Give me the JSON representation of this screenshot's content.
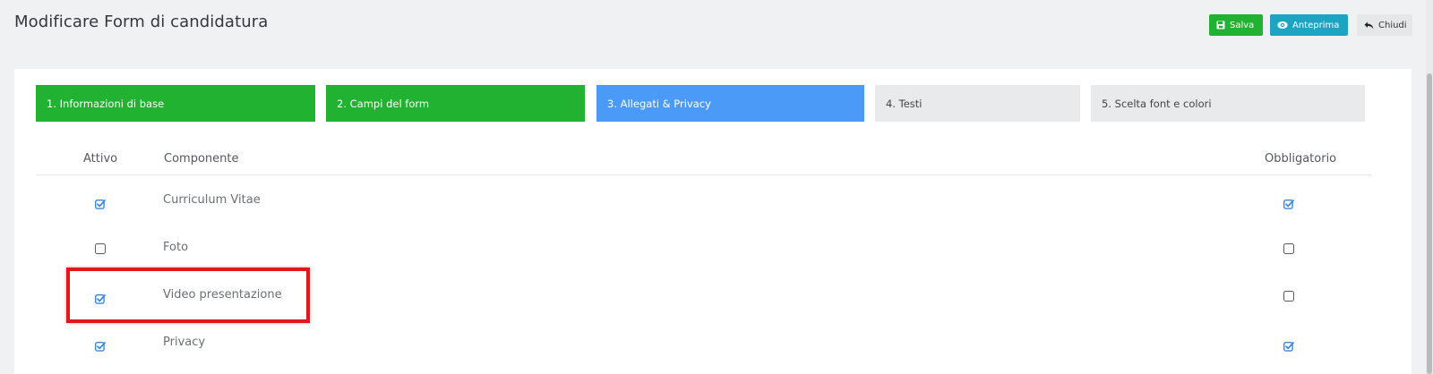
{
  "header": {
    "title": "Modificare Form di candidatura",
    "buttons": {
      "save": "Salva",
      "preview": "Anteprima",
      "close": "Chiudi"
    }
  },
  "steps": [
    {
      "number": "1.",
      "label": "Informazioni di base",
      "state": "done"
    },
    {
      "number": "2.",
      "label": "Campi del form",
      "state": "done"
    },
    {
      "number": "3.",
      "label": "Allegati & Privacy",
      "state": "active"
    },
    {
      "number": "4.",
      "label": "Testi",
      "state": "todo"
    },
    {
      "number": "5.",
      "label": "Scelta font e colori",
      "state": "todo"
    }
  ],
  "table": {
    "columns": {
      "active": "Attivo",
      "component": "Componente",
      "required": "Obbligatorio"
    },
    "rows": [
      {
        "component": "Curriculum Vitae",
        "active": true,
        "required": true
      },
      {
        "component": "Foto",
        "active": false,
        "required": false
      },
      {
        "component": "Video presentazione",
        "active": true,
        "required": false
      },
      {
        "component": "Privacy",
        "active": true,
        "required": true
      }
    ]
  },
  "colors": {
    "done": "#20b230",
    "active": "#4c9af7",
    "todo": "#e8eaeb",
    "preview_button": "#1ea4c3",
    "highlight": "#e2171c",
    "checkbox_checked": "#3b86e0"
  },
  "icons": {
    "save": "floppy-disk-icon",
    "preview": "eye-icon",
    "close": "reply-arrow-icon",
    "checked": "checkbox-checked-icon",
    "unchecked": "checkbox-empty-icon"
  }
}
